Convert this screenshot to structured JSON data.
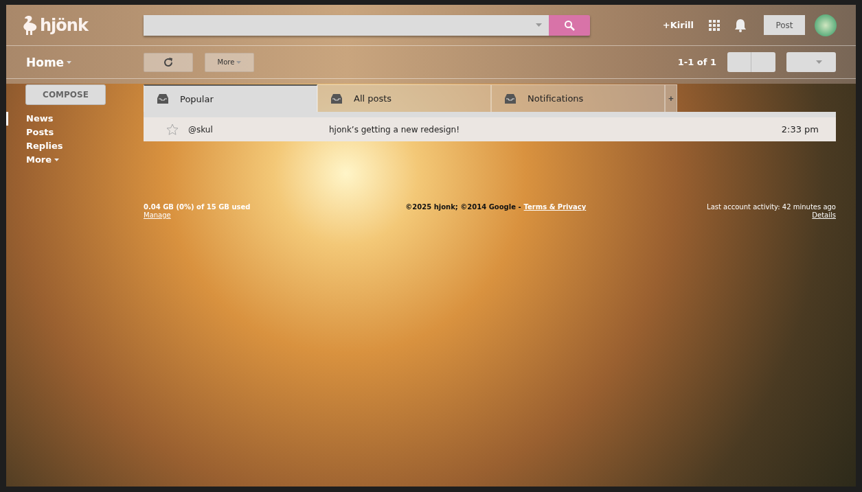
{
  "header": {
    "logo": "hjönk",
    "user": "+Kirill",
    "post_button": "Post"
  },
  "toolbar": {
    "title": "Home",
    "more_button": "More",
    "pagination": "1-1 of 1"
  },
  "sidebar": {
    "compose": "COMPOSE",
    "items": [
      {
        "label": "News",
        "selected": true,
        "dropdown": false
      },
      {
        "label": "Posts",
        "selected": false,
        "dropdown": false
      },
      {
        "label": "Replies",
        "selected": false,
        "dropdown": false
      },
      {
        "label": "More",
        "selected": false,
        "dropdown": true
      }
    ]
  },
  "tabs": [
    {
      "label": "Popular",
      "selected": true
    },
    {
      "label": "All posts",
      "selected": false
    },
    {
      "label": "Notifications",
      "selected": false
    }
  ],
  "add_tab": "+",
  "messages": [
    {
      "starred": false,
      "sender": "@skul",
      "subject": "hjonk’s getting a new redesign!",
      "time": "2:33 pm"
    }
  ],
  "footer": {
    "storage": "0.04 GB (0%) of 15 GB used",
    "manage": "Manage",
    "copyright": "©2025 hjonk; ©2014 Google - ",
    "terms": "Terms & Privacy",
    "activity": "Last account activity: 42 minutes ago",
    "details": "Details"
  }
}
